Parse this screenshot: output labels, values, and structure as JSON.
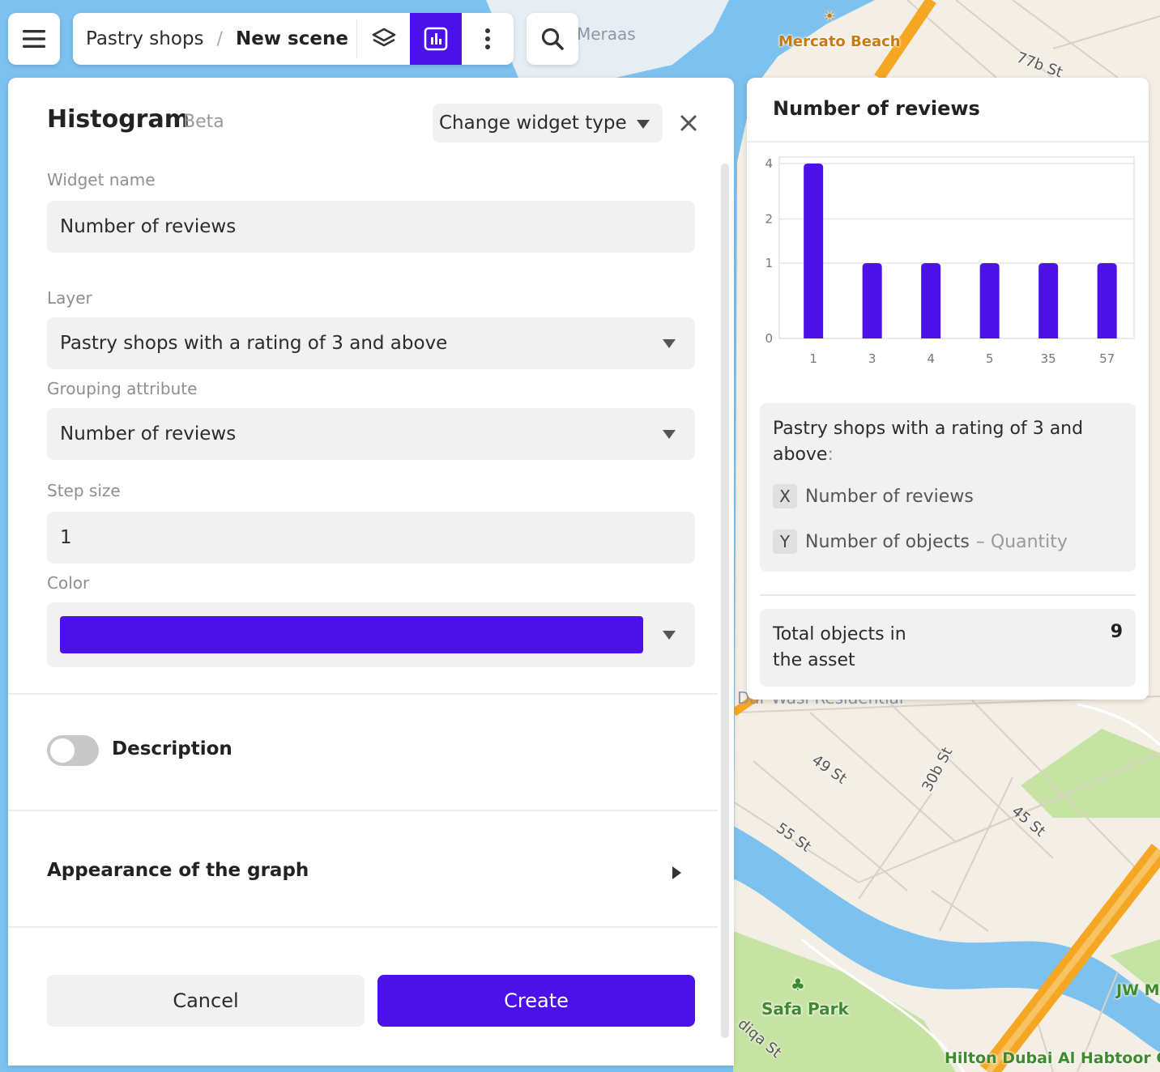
{
  "map": {
    "labels": {
      "mercato_beach": "Mercato Beach",
      "st_77b": "77b St",
      "meraas": "Meraas",
      "dar_wasl": "Dar Wasl Residential",
      "st_49": "49 St",
      "st_30b": "30b St",
      "st_45": "45 St",
      "st_55": "55 St",
      "safa_park": "Safa Park",
      "hilton": "Hilton Dubai Al Habtoor City",
      "jw": "JW Ma",
      "sadiqa": "diqa St"
    }
  },
  "topbar": {
    "breadcrumb_project": "Pastry shops",
    "breadcrumb_separator": "/",
    "breadcrumb_scene": "New scene"
  },
  "panel": {
    "title": "Histogram",
    "badge": "Beta",
    "change_widget_type": "Change widget type",
    "widget_name_label": "Widget name",
    "widget_name_value": "Number of reviews",
    "layer_label": "Layer",
    "layer_value": "Pastry shops with a rating of 3 and above",
    "grouping_label": "Grouping attribute",
    "grouping_value": "Number of reviews",
    "step_label": "Step size",
    "step_value": "1",
    "color_label": "Color",
    "color_value": "#4b11e8",
    "description_label": "Description",
    "description_enabled": false,
    "appearance_label": "Appearance of the graph",
    "cancel_label": "Cancel",
    "create_label": "Create"
  },
  "widget": {
    "title": "Number of reviews",
    "layer_name": "Pastry shops with a rating of 3 and above",
    "layer_colon": ":",
    "x_badge": "X",
    "x_label": "Number of reviews",
    "y_badge": "Y",
    "y_label": "Number of objects",
    "y_note": "– Quantity",
    "total_label": "Total objects in the asset",
    "total_value": "9"
  },
  "chart_data": {
    "type": "bar",
    "categories": [
      "1",
      "3",
      "4",
      "5",
      "35",
      "57"
    ],
    "values": [
      4,
      1,
      1,
      1,
      1,
      1
    ],
    "y_ticks": [
      "0",
      "1",
      "2",
      "4"
    ],
    "y_scale": "log",
    "xlabel": "",
    "ylabel": "",
    "color": "#4b11e8",
    "grid": true
  },
  "colors": {
    "accent": "#4b11e8",
    "water": "#7dc1ef",
    "park": "#c6e3a4",
    "land": "#f4efe6",
    "road_major": "#f5a623"
  }
}
